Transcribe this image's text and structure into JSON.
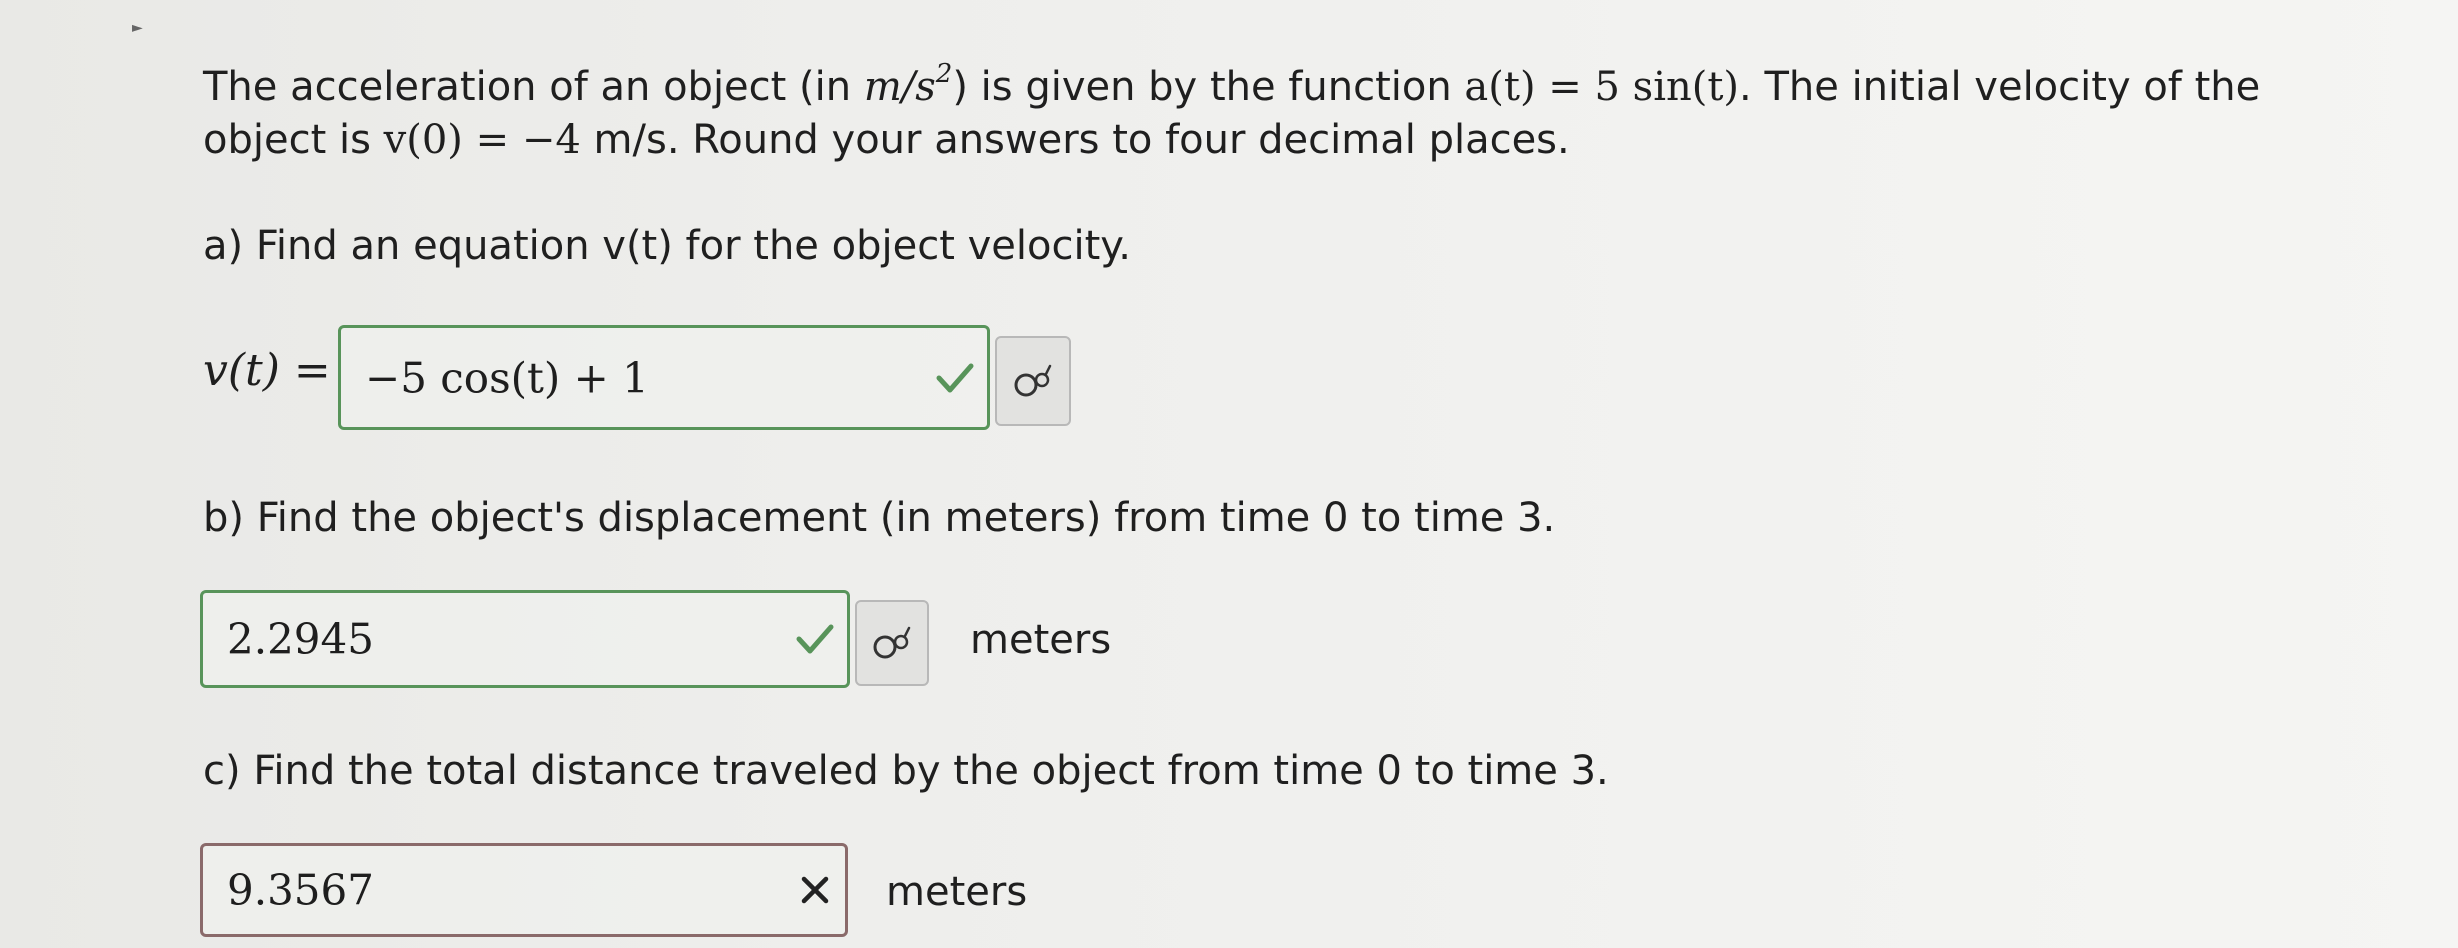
{
  "problem": {
    "line1_text1": "The acceleration of an object (in ",
    "line1_unit_base": "m/s",
    "line1_unit_exp": "2",
    "line1_text2": ") is given by the function ",
    "line1_math": "a(t) = 5 sin(t)",
    "line1_text3": ". The initial velocity of the",
    "line2_text1": "object is ",
    "line2_math": "v(0) = −4",
    "line2_text2": " m/s. Round your answers to four decimal places."
  },
  "part_a": {
    "question": "a) Find an equation v(t) for the object velocity.",
    "lhs": "v(t) =",
    "answer": "−5 cos(t) + 1",
    "status": "correct",
    "preview_icon": "formula-preview-icon"
  },
  "part_b": {
    "question": "b) Find the object's displacement (in meters) from time 0 to time 3.",
    "answer": "2.2945",
    "status": "correct",
    "unit": "meters",
    "preview_icon": "formula-preview-icon"
  },
  "part_c": {
    "question": "c) Find the total distance traveled by the object from time 0 to time 3.",
    "answer": "9.3567",
    "status": "incorrect",
    "unit": "meters"
  },
  "colors": {
    "correct": "#58945a",
    "incorrect": "#222222",
    "border_correct": "#58945a",
    "border_incorrect": "#8a6a6a"
  }
}
